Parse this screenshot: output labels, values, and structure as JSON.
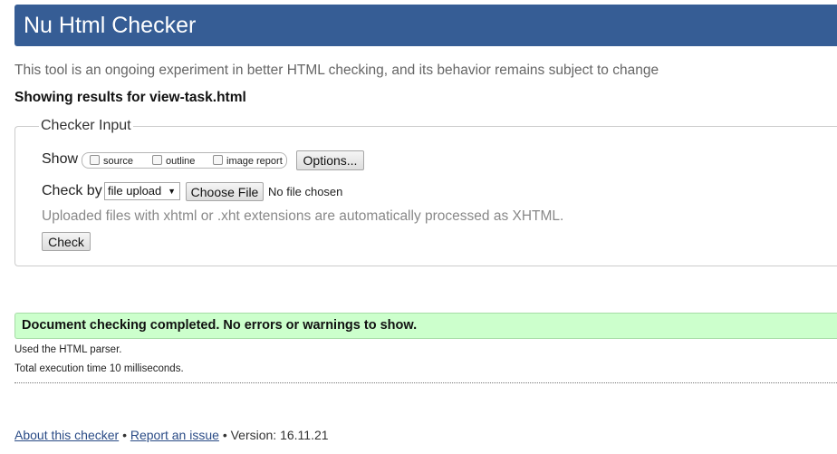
{
  "header": {
    "title": "Nu Html Checker"
  },
  "tagline": "This tool is an ongoing experiment in better HTML checking, and its behavior remains subject to change",
  "results_for": "Showing results for view-task.html",
  "checker_input": {
    "legend": "Checker Input",
    "show_label": "Show",
    "show_options": [
      "source",
      "outline",
      "image report"
    ],
    "options_button": "Options...",
    "check_by_label": "Check by",
    "check_by_value": "file upload",
    "choose_file_button": "Choose File",
    "no_file_text": "No file chosen",
    "hint": "Uploaded files with xhtml or .xht extensions are automatically processed as XHTML.",
    "check_button": "Check"
  },
  "result": {
    "message": "Document checking completed. No errors or warnings to show.",
    "parser": "Used the HTML parser.",
    "time": "Total execution time 10 milliseconds."
  },
  "footer": {
    "about_link": "About this checker",
    "separator": "•",
    "report_link": "Report an issue",
    "version": "Version: 16.11.21"
  },
  "colors": {
    "header_bg": "#365d95",
    "success_bg": "#ccffcc",
    "link": "#2a4b86"
  }
}
